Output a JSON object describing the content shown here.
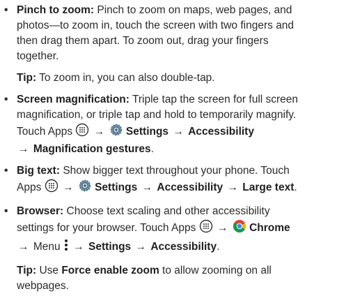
{
  "pinch": {
    "title": "Pinch to zoom:",
    "text_line1": "Pinch to zoom on maps, web pages, and",
    "text_line2": "photos—to zoom in, touch the screen with two fingers and",
    "text_line3": "then drag them apart. To zoom out, drag your fingers",
    "text_line4": "together."
  },
  "tip1": {
    "label": "Tip:",
    "text": "To zoom in, you can also double-tap."
  },
  "magnification": {
    "title": "Screen magnification:",
    "text_line1": "Triple tap the screen for full screen",
    "text_line2": "magnification, or triple tap and hold to temporarily magnify.",
    "touch_apps": "Touch Apps",
    "settings": "Settings",
    "accessibility": "Accessibility",
    "gestures": "Magnification gestures",
    "end": "."
  },
  "bigtext": {
    "title": "Big text:",
    "text_line1": "Show bigger text throughout your phone. Touch",
    "apps": "Apps",
    "settings": "Settings",
    "accessibility": "Accessibility",
    "large_text": "Large text",
    "end": "."
  },
  "browser": {
    "title": "Browser:",
    "text_line1": "Choose text scaling and other accessibility",
    "text_line2": "settings for your browser. Touch Apps",
    "chrome": "Chrome",
    "menu": "Menu",
    "settings": "Settings",
    "accessibility": "Accessibility",
    "end": "."
  },
  "tip2": {
    "label": "Tip:",
    "pre": "Use",
    "force": "Force enable zoom",
    "post": "to allow zooming on all",
    "line2": "webpages."
  },
  "symbols": {
    "bullet": "•",
    "arrow": "→"
  },
  "icons": [
    "apps-icon",
    "settings-gear-icon",
    "chrome-icon",
    "menu-dots-icon"
  ]
}
